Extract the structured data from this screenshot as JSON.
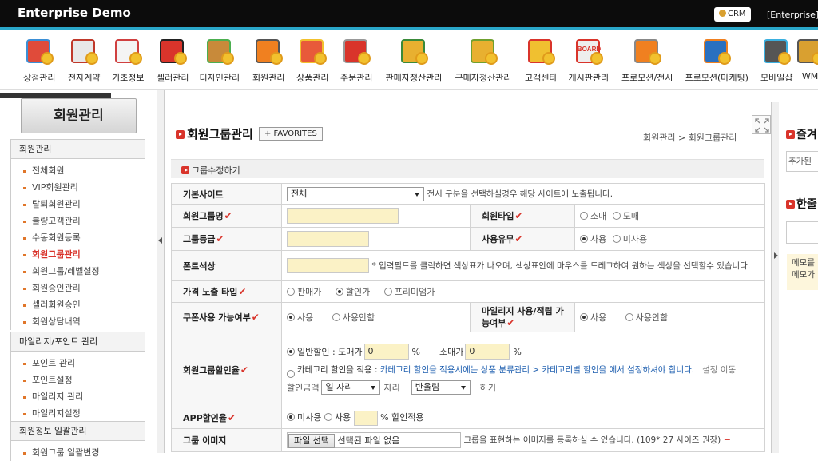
{
  "app": {
    "title": "Enterprise Demo",
    "crm_label": "CRM",
    "enterprise_label": "[Enterprise] f"
  },
  "menu": [
    {
      "label": "상점관리",
      "icon": "shop-icon"
    },
    {
      "label": "전자계약",
      "icon": "contract-icon"
    },
    {
      "label": "기초정보",
      "icon": "document-icon"
    },
    {
      "label": "셀러관리",
      "icon": "seller-icon"
    },
    {
      "label": "디자인관리",
      "icon": "palette-icon"
    },
    {
      "label": "회원관리",
      "icon": "member-icon"
    },
    {
      "label": "상품관리",
      "icon": "product-icon"
    },
    {
      "label": "주문관리",
      "icon": "basket-icon"
    },
    {
      "label": "판매자정산관리",
      "icon": "money-icon"
    },
    {
      "label": "구매자정산관리",
      "icon": "coins-icon"
    },
    {
      "label": "고객센타",
      "icon": "question-icon"
    },
    {
      "label": "게시판관리",
      "icon": "board-icon"
    },
    {
      "label": "프로모션/전시",
      "icon": "shirt-icon"
    },
    {
      "label": "프로모션(마케팅)",
      "icon": "hanger-icon"
    },
    {
      "label": "모바일샵",
      "icon": "mobile-icon"
    },
    {
      "label": "WM",
      "icon": "wm-icon"
    }
  ],
  "board_icon_text": "BOARD",
  "sidebar": {
    "header": "회원관리",
    "groups": [
      {
        "title": "회원관리",
        "items": [
          "전체회원",
          "VIP회원관리",
          "탈퇴회원관리",
          "불량고객관리",
          "수동회원등록",
          "회원그룹관리",
          "회원그룹/레벨설정",
          "회원승인관리",
          "셀러회원승인",
          "회원상담내역"
        ]
      },
      {
        "title": "마일리지/포인트 관리",
        "items": [
          "포인트 관리",
          "포인트설정",
          "마일리지 관리",
          "마일리지설정"
        ]
      },
      {
        "title": "회원정보 일괄관리",
        "items": [
          "회원그룹 일괄변경"
        ]
      }
    ]
  },
  "page": {
    "title": "회원그룹관리",
    "favorites": "+ FAVORITES",
    "breadcrumb": "회원관리 > 회원그룹관리",
    "section": "그룹수정하기"
  },
  "form": {
    "site_label": "기본사이트",
    "site_value": "전체",
    "site_note": "전시 구분을 선택하실경우 해당 사이트에 노출됩니다.",
    "group_name_label": "회원그룹명",
    "member_type_label": "회원타입",
    "member_type_opts": [
      "소매",
      "도매"
    ],
    "grade_label": "그룹등급",
    "use_label": "사용유무",
    "use_opts": [
      "사용",
      "미사용"
    ],
    "font_color_label": "폰트색상",
    "font_color_note": "* 입력필드를 클릭하면 색상표가 나오며, 색상표안에 마우스를 드레그하여 원하는 색상을 선택할수 있습니다.",
    "price_type_label": "가격 노출 타입",
    "price_type_opts": [
      "판매가",
      "할인가",
      "프리미엄가"
    ],
    "coupon_label": "쿠폰사용 가능여부",
    "coupon_opts": [
      "사용",
      "사용안함"
    ],
    "mileage_label": "마일리지 사용/적립 가능여부",
    "mileage_opts": [
      "사용",
      "사용안함"
    ],
    "discount_label": "회원그룹할인율",
    "discount_normal": "일반할인 : 도매가",
    "discount_wholesale_value": "0",
    "percent": "%",
    "discount_retail": "소매가",
    "discount_retail_value": "0",
    "category_discount_prefix": "카테고리 할인을 적용 : ",
    "category_discount_note": "카테고리 할인을 적용시에는 상품 분류관리 > 카테고리별 할인을 에서 설정하셔야 합니다.",
    "category_discount_suffix": "설정 이동",
    "amount_label": "할인금액",
    "digit_value": "일 자리",
    "digit_suffix": "자리",
    "round_value": "반올림",
    "round_suffix": "하기",
    "app_label": "APP할인율",
    "app_opts": [
      "미사용",
      "사용"
    ],
    "app_suffix": "% 할인적용",
    "image_label": "그룹 이미지",
    "file_button": "파일 선택",
    "file_none": "선택된 파일 없음",
    "image_note": "그룹을 표현하는 이미지를 등록하실 수 있습니다. (109* 27 사이즈 권장)",
    "image_note_end": "−"
  },
  "right": {
    "title1": "즐겨",
    "added": "추가된",
    "title2": "한줄",
    "memo1": "메모를",
    "memo2": "메모가"
  }
}
